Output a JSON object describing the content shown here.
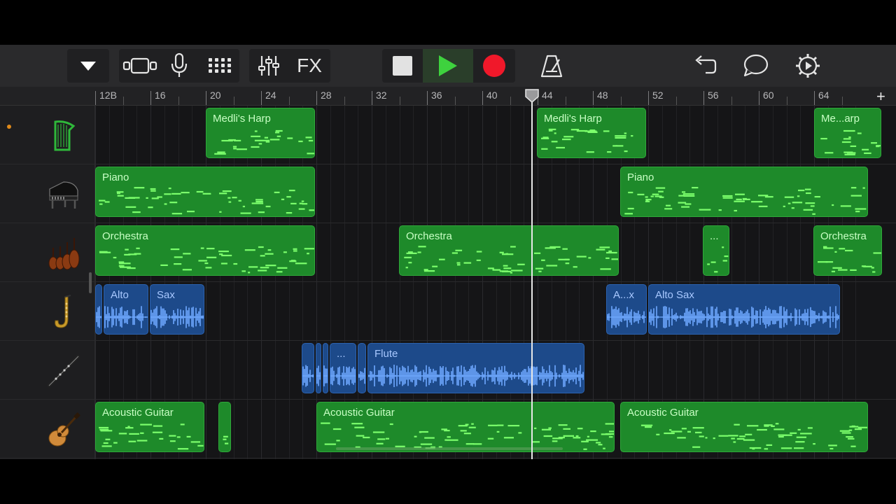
{
  "toolbar": {
    "fx_label": "FX",
    "icons": [
      "tracks-dropdown-icon",
      "view-toggle-icon",
      "microphone-icon",
      "keyboard-grid-icon",
      "mixer-icon",
      "stop-icon",
      "play-icon",
      "record-icon",
      "metronome-icon",
      "undo-icon",
      "loop-icon",
      "settings-icon"
    ],
    "colors": {
      "play": "#3ed23e",
      "record": "#f0182a",
      "accent": "#2fa83a"
    }
  },
  "ruler": {
    "labels": [
      "12B",
      "16",
      "20",
      "24",
      "28",
      "32",
      "36",
      "40",
      "44",
      "48",
      "52",
      "56",
      "60",
      "64"
    ],
    "add_label": "+"
  },
  "tracks": [
    {
      "instrument": "harp",
      "icon": "harp-icon",
      "selected": true,
      "regions": [
        {
          "name": "Medli's Harp",
          "kind": "midi"
        },
        {
          "name": "Medli's Harp",
          "kind": "midi"
        },
        {
          "name": "Me...arp",
          "kind": "midi"
        }
      ]
    },
    {
      "instrument": "piano",
      "icon": "grand-piano-icon",
      "selected": false,
      "regions": [
        {
          "name": "Piano",
          "kind": "midi"
        },
        {
          "name": "Piano",
          "kind": "midi"
        }
      ]
    },
    {
      "instrument": "orchestra",
      "icon": "violins-icon",
      "selected": false,
      "regions": [
        {
          "name": "Orchestra",
          "kind": "midi"
        },
        {
          "name": "Orchestra",
          "kind": "midi"
        },
        {
          "name": "...",
          "kind": "midi"
        },
        {
          "name": "Orchestra",
          "kind": "midi"
        }
      ]
    },
    {
      "instrument": "alto-sax",
      "icon": "saxophone-icon",
      "selected": false,
      "regions": [
        {
          "name": "",
          "kind": "audio"
        },
        {
          "name": "Alto",
          "kind": "audio"
        },
        {
          "name": "Sax",
          "kind": "audio"
        },
        {
          "name": "A...x",
          "kind": "audio"
        },
        {
          "name": "Alto Sax",
          "kind": "audio"
        }
      ]
    },
    {
      "instrument": "flute",
      "icon": "flute-icon",
      "selected": false,
      "regions": [
        {
          "name": "",
          "kind": "audio"
        },
        {
          "name": "",
          "kind": "audio"
        },
        {
          "name": "",
          "kind": "audio"
        },
        {
          "name": "...",
          "kind": "audio"
        },
        {
          "name": "",
          "kind": "audio"
        },
        {
          "name": "Flute",
          "kind": "audio"
        }
      ]
    },
    {
      "instrument": "acoustic-guitar",
      "icon": "acoustic-guitar-icon",
      "selected": false,
      "regions": [
        {
          "name": "Acoustic Guitar",
          "kind": "midi"
        },
        {
          "name": "",
          "kind": "midi"
        },
        {
          "name": "Acoustic Guitar",
          "kind": "midi"
        },
        {
          "name": "Acoustic Guitar",
          "kind": "midi"
        }
      ]
    }
  ]
}
